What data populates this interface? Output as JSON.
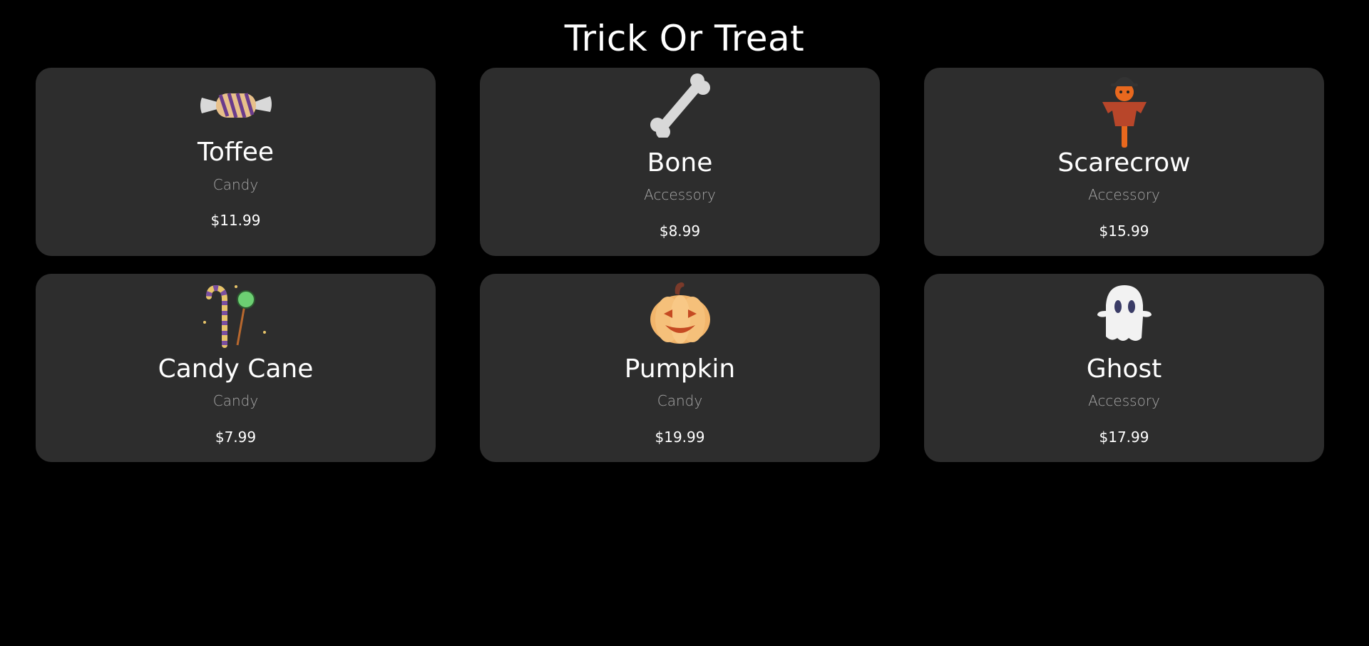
{
  "header": {
    "title": "Trick Or Treat"
  },
  "products": [
    {
      "name": "Toffee",
      "category": "Candy",
      "price": "$11.99",
      "icon": "toffee-candy-icon"
    },
    {
      "name": "Bone",
      "category": "Accessory",
      "price": "$8.99",
      "icon": "bone-icon"
    },
    {
      "name": "Scarecrow",
      "category": "Accessory",
      "price": "$15.99",
      "icon": "scarecrow-icon"
    },
    {
      "name": "Candy Cane",
      "category": "Candy",
      "price": "$7.99",
      "icon": "candy-cane-icon"
    },
    {
      "name": "Pumpkin",
      "category": "Candy",
      "price": "$19.99",
      "icon": "pumpkin-icon"
    },
    {
      "name": "Ghost",
      "category": "Accessory",
      "price": "$17.99",
      "icon": "ghost-icon"
    }
  ],
  "colors": {
    "background": "#000000",
    "card": "#2d2d2d",
    "text": "#ffffff",
    "muted": "#a8a8a8"
  }
}
